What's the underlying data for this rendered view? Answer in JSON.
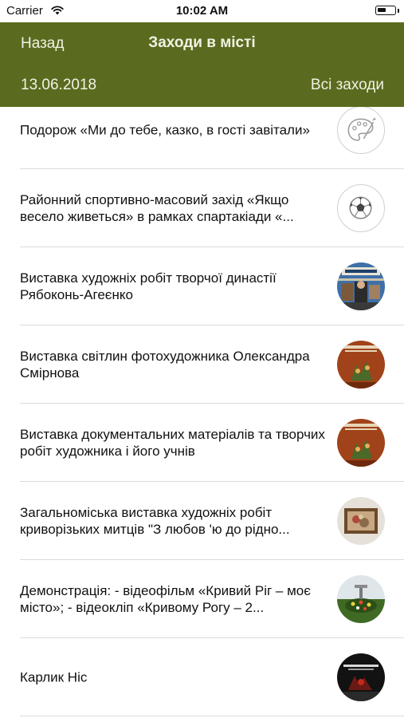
{
  "status_bar": {
    "carrier": "Carrier",
    "time": "10:02 AM",
    "battery_level": 0.55
  },
  "navbar": {
    "back_label": "Назад",
    "title": "Заходи в місті",
    "date": "13.06.2018",
    "all_events_label": "Всі заходи",
    "color": "#5a6b1f"
  },
  "events": [
    {
      "title": "Подорож «Ми до тебе, казко, в гості завітали»",
      "icon": "palette-icon"
    },
    {
      "title": "Районний спортивно-масовий захід «Якщо весело живеться» в рамках спартакіади «...",
      "icon": "soccer-ball-icon"
    },
    {
      "title": "Виставка художніх робіт творчої династії Рябоконь-Агеєнко",
      "icon": "exhibition-poster-thumbnail"
    },
    {
      "title": "Виставка світлин фотохудожника Олександра Смірнова",
      "icon": "brown-poster-thumbnail"
    },
    {
      "title": "Виставка документальних матеріалів та творчих робіт художника і його учнів",
      "icon": "brown-poster-thumbnail"
    },
    {
      "title": "Загальноміська виставка художніх робіт криворізьких митців \"З любов 'ю до рідно...",
      "icon": "framed-painting-thumbnail"
    },
    {
      "title": "Демонстрація: - відеофільм «Кривий Ріг – моє місто»; - відеокліп «Кривому Рогу – 2...",
      "icon": "flowerbed-photo-thumbnail"
    },
    {
      "title": "Карлик Ніс",
      "icon": "dark-stage-thumbnail"
    }
  ]
}
